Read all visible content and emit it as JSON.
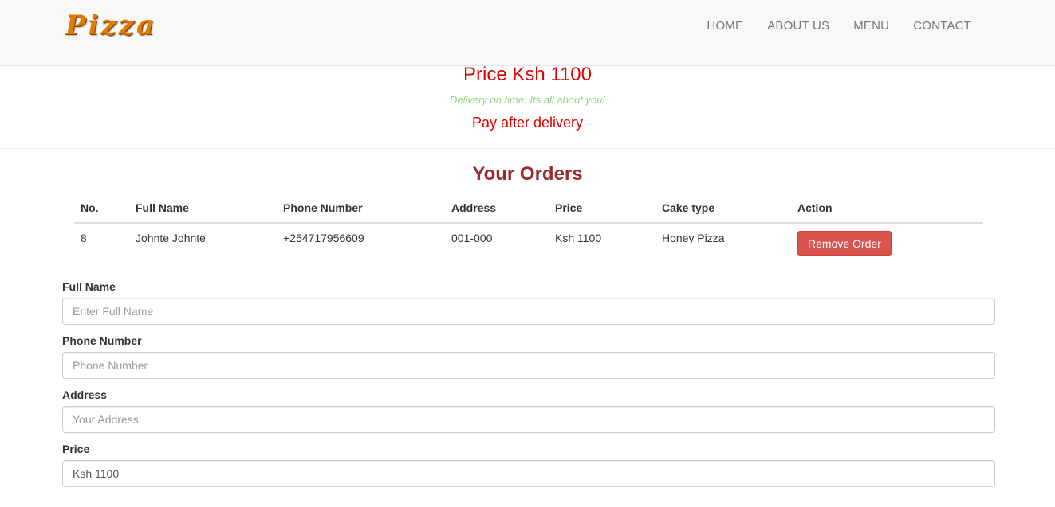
{
  "brand": {
    "logo_text": "Pizza"
  },
  "nav": {
    "items": [
      "HOME",
      "ABOUT US",
      "MENU",
      "CONTACT"
    ]
  },
  "hero": {
    "price": "Price Ksh 1100",
    "tagline": "Delivery on time. Its all about you!",
    "pay_note": "Pay after delivery"
  },
  "orders": {
    "title": "Your Orders",
    "columns": [
      "No.",
      "Full Name",
      "Phone Number",
      "Address",
      "Price",
      "Cake type",
      "Action"
    ],
    "rows": [
      {
        "no": "8",
        "full_name": "Johnte Johnte",
        "phone": "+254717956609",
        "address": "001-000",
        "price": "Ksh 1100",
        "cake_type": "Honey Pizza",
        "action_label": "Remove Order"
      }
    ]
  },
  "form": {
    "full_name": {
      "label": "Full Name",
      "placeholder": "Enter Full Name",
      "value": ""
    },
    "phone": {
      "label": "Phone Number",
      "placeholder": "Phone Number",
      "value": ""
    },
    "address": {
      "label": "Address",
      "placeholder": "Your Address",
      "value": ""
    },
    "price": {
      "label": "Price",
      "placeholder": "",
      "value": "Ksh 1100"
    }
  },
  "colors": {
    "price_red": "#e00000",
    "tagline_green": "#8fdc7a",
    "title_maroon": "#9b2a2a",
    "danger_button": "#d9534f",
    "logo_orange": "#e07b00"
  }
}
